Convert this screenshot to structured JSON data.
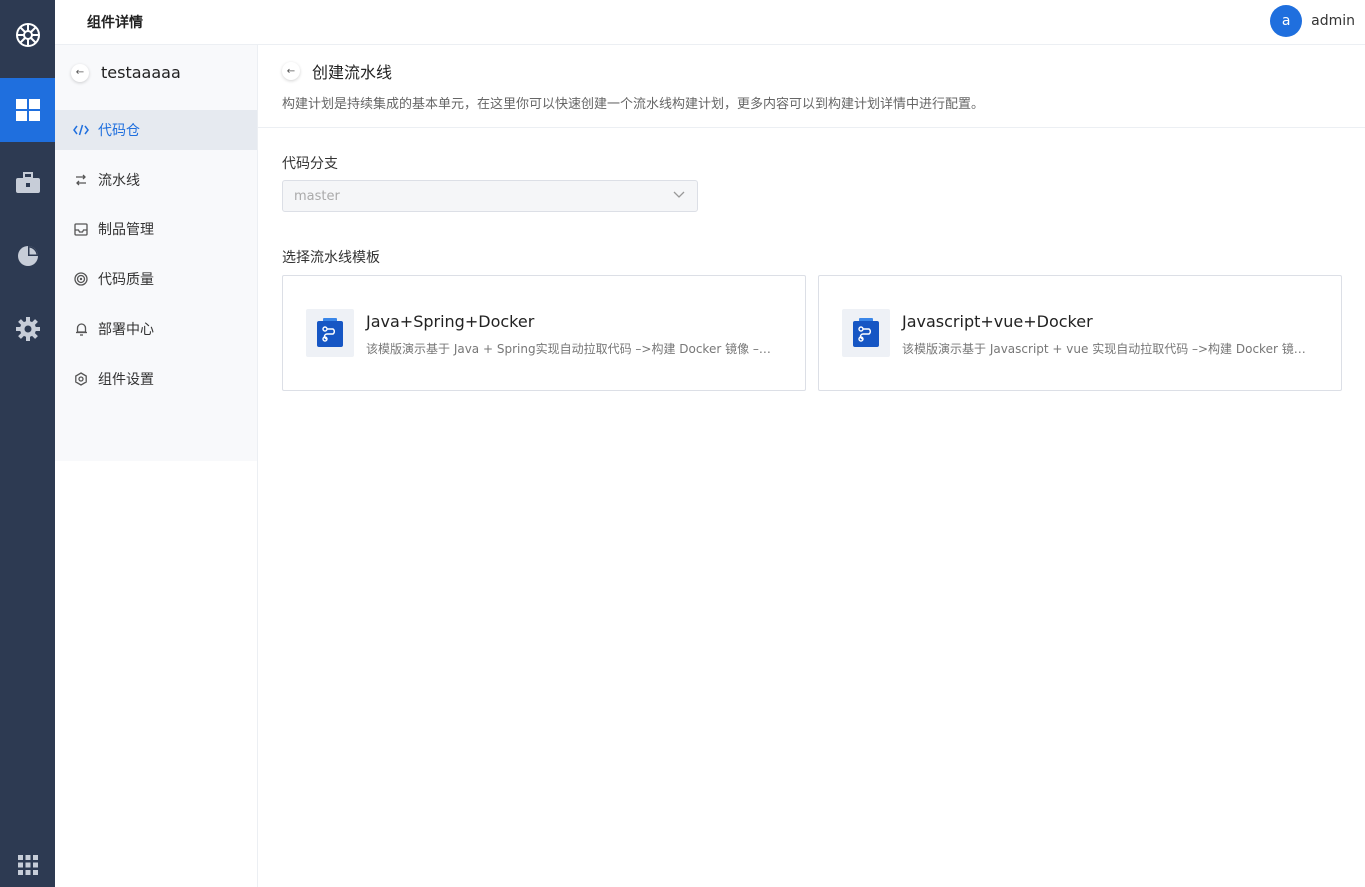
{
  "header": {
    "title": "组件详情"
  },
  "user": {
    "avatar_letter": "a",
    "name": "admin"
  },
  "rail": {
    "logo_icon": "helm-wheel-icon",
    "items": [
      {
        "icon": "grid-icon",
        "active": true
      },
      {
        "icon": "briefcase-icon",
        "active": false
      },
      {
        "icon": "pie-chart-icon",
        "active": false
      },
      {
        "icon": "gear-icon",
        "active": false
      }
    ],
    "bottom_icon": "apps-grid-icon"
  },
  "subnav": {
    "project_name": "testaaaaa",
    "items": [
      {
        "label": "代码仓",
        "icon": "code-icon",
        "active": true
      },
      {
        "label": "流水线",
        "icon": "pipeline-icon",
        "active": false
      },
      {
        "label": "制品管理",
        "icon": "inbox-icon",
        "active": false
      },
      {
        "label": "代码质量",
        "icon": "target-icon",
        "active": false
      },
      {
        "label": "部署中心",
        "icon": "bell-icon",
        "active": false
      },
      {
        "label": "组件设置",
        "icon": "settings-icon",
        "active": false
      }
    ]
  },
  "main": {
    "title": "创建流水线",
    "description": "构建计划是持续集成的基本单元，在这里你可以快速创建一个流水线构建计划，更多内容可以到构建计划详情中进行配置。",
    "branch": {
      "label": "代码分支",
      "value": "master"
    },
    "template_label": "选择流水线模板",
    "templates": [
      {
        "title": "Java+Spring+Docker",
        "desc": "该模版演示基于 Java + Spring实现自动拉取代码 –>构建 Docker 镜像 –>推送镜像 –>部署"
      },
      {
        "title": "Javascript+vue+Docker",
        "desc": "该模版演示基于 Javascript + vue 实现自动拉取代码 –>构建 Docker 镜像 –>推送镜像 –>部署"
      }
    ]
  },
  "colors": {
    "accent": "#1f6fde",
    "rail_bg": "#2d3a52"
  }
}
